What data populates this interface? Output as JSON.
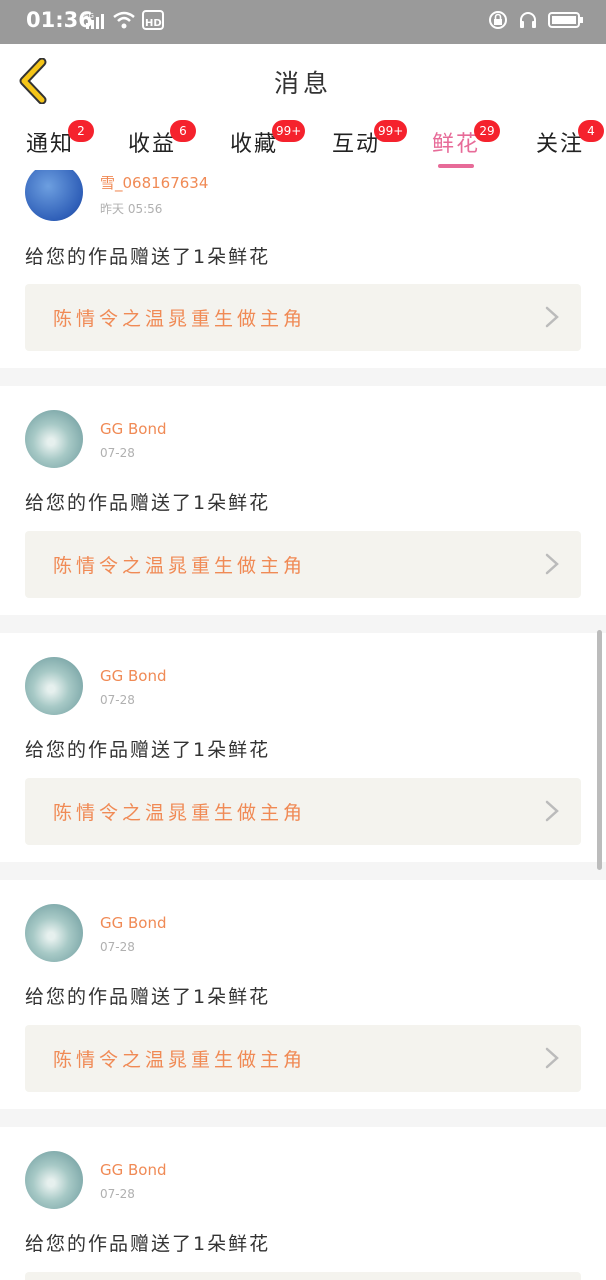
{
  "status_bar": {
    "time": "01:36",
    "icons": [
      "network-4g-icon",
      "wifi-icon",
      "hd-icon",
      "lock-rotation-icon",
      "headset-icon",
      "battery-icon"
    ]
  },
  "header": {
    "title": "消息",
    "back_icon": "chevron-left-icon"
  },
  "tabs": [
    {
      "label": "通知",
      "badge": "2"
    },
    {
      "label": "收益",
      "badge": "6"
    },
    {
      "label": "收藏",
      "badge": "99+"
    },
    {
      "label": "互动",
      "badge": "99+"
    },
    {
      "label": "鲜花",
      "badge": "29",
      "active": true
    },
    {
      "label": "关注",
      "badge": "4"
    }
  ],
  "feed": [
    {
      "user": "雪_068167634",
      "time": "昨天 05:56",
      "text": "给您的作品赠送了1朵鲜花",
      "work": "陈情令之温晁重生做主角"
    },
    {
      "user": "GG Bond",
      "time": "07-28",
      "text": "给您的作品赠送了1朵鲜花",
      "work": "陈情令之温晁重生做主角"
    },
    {
      "user": "GG Bond",
      "time": "07-28",
      "text": "给您的作品赠送了1朵鲜花",
      "work": "陈情令之温晁重生做主角"
    },
    {
      "user": "GG Bond",
      "time": "07-28",
      "text": "给您的作品赠送了1朵鲜花",
      "work": "陈情令之温晁重生做主角"
    },
    {
      "user": "GG Bond",
      "time": "07-28",
      "text": "给您的作品赠送了1朵鲜花",
      "work": ""
    }
  ],
  "colors": {
    "accent_pink": "#e76b98",
    "name_orange": "#f08a55",
    "badge_red": "#f5222d",
    "back_yellow": "#f5c518"
  }
}
